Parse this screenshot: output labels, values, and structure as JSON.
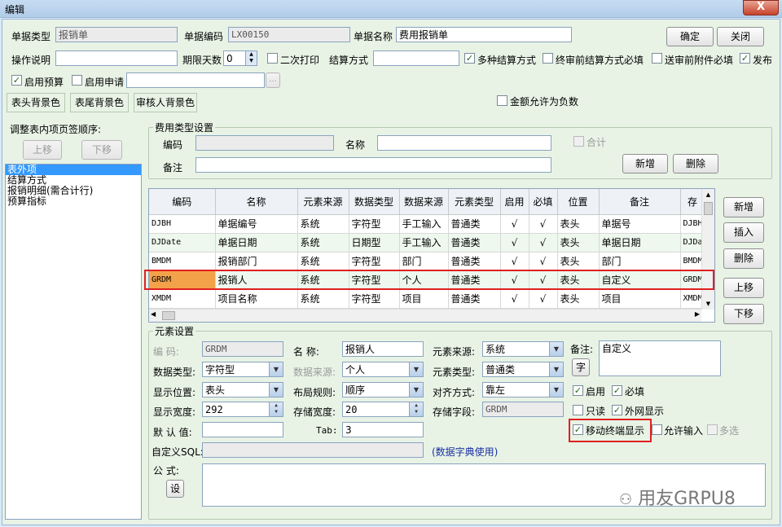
{
  "window": {
    "title": "编辑",
    "close": "X"
  },
  "top": {
    "doc_type_label": "单据类型",
    "doc_type_value": "报销单",
    "doc_code_label": "单据编码",
    "doc_code_value": "LX00150",
    "doc_name_label": "单据名称",
    "doc_name_value": "费用报销单",
    "ok": "确定",
    "close": "关闭",
    "op_desc_label": "操作说明",
    "op_desc_value": "",
    "deadline_label": "期限天数",
    "deadline_value": "0",
    "reprint_label": "二次打印",
    "settle_label": "结算方式",
    "settle_value": "",
    "multi_settle_label": "多种结算方式",
    "final_settle_label": "终审前结算方式必填",
    "attach_label": "送审前附件必填",
    "publish_label": "发布",
    "budget_label": "启用预算",
    "apply_label": "启用申请",
    "apply_value": "",
    "apply_btn": "...",
    "negative_label": "金额允许为负数",
    "tabs": [
      "表头背景色",
      "表尾背景色",
      "审核人背景色"
    ]
  },
  "left": {
    "label": "调整表内项页签顺序:",
    "up": "上移",
    "down": "下移",
    "items": [
      "表外项",
      "结算方式",
      "报销明细(需合计行)",
      "预算指标"
    ]
  },
  "expense": {
    "title": "费用类型设置",
    "code_label": "编码",
    "code_value": "",
    "name_label": "名称",
    "name_value": "",
    "total_label": "合计",
    "note_label": "备注",
    "note_value": "",
    "add": "新增",
    "delete": "删除"
  },
  "grid": {
    "columns": [
      "编码",
      "名称",
      "元素来源",
      "数据类型",
      "数据来源",
      "元素类型",
      "启用",
      "必填",
      "位置",
      "备注",
      "存"
    ],
    "rows": [
      [
        "DJBH",
        "单据编号",
        "系统",
        "字符型",
        "手工输入",
        "普通类",
        "√",
        "√",
        "表头",
        "单据号",
        "DJBH"
      ],
      [
        "DJDate",
        "单据日期",
        "系统",
        "日期型",
        "手工输入",
        "普通类",
        "√",
        "√",
        "表头",
        "单据日期",
        "DJDa"
      ],
      [
        "BMDM",
        "报销部门",
        "系统",
        "字符型",
        "部门",
        "普通类",
        "√",
        "√",
        "表头",
        "部门",
        "BMDM"
      ],
      [
        "GRDM",
        "报销人",
        "系统",
        "字符型",
        "个人",
        "普通类",
        "√",
        "√",
        "表头",
        "自定义",
        "GRDM"
      ],
      [
        "XMDM",
        "项目名称",
        "系统",
        "字符型",
        "项目",
        "普通类",
        "√",
        "√",
        "表头",
        "项目",
        "XMDM"
      ]
    ]
  },
  "side_buttons": [
    "新增",
    "插入",
    "删除",
    "上移",
    "下移"
  ],
  "element": {
    "title": "元素设置",
    "code_label": "编    码:",
    "code_value": "GRDM",
    "name_label": "名    称:",
    "name_value": "报销人",
    "source_label": "元素来源:",
    "source_value": "系统",
    "remark_label": "备注:",
    "remark_value": "自定义",
    "dtype_label": "数据类型:",
    "dtype_value": "字符型",
    "dsource_label": "数据来源:",
    "dsource_value": "个人",
    "etype_label": "元素类型:",
    "etype_value": "普通类",
    "char_btn": "字",
    "pos_label": "显示位置:",
    "pos_value": "表头",
    "layout_label": "布局规则:",
    "layout_value": "顺序",
    "align_label": "对齐方式:",
    "align_value": "靠左",
    "enable_label": "启用",
    "required_label": "必填",
    "width_label": "显示宽度:",
    "width_value": "292",
    "swidth_label": "存储宽度:",
    "swidth_value": "20",
    "sfield_label": "存储字段:",
    "sfield_value": "GRDM",
    "readonly_label": "只读",
    "extnet_label": "外网显示",
    "default_label": "默 认 值:",
    "default_value": "",
    "tab_label": "Tab:",
    "tab_value": "3",
    "mobile_label": "移动终端显示",
    "allow_input_label": "允许输入",
    "multi_label": "多选",
    "sql_label": "自定义SQL:",
    "sql_value": "",
    "sql_hint": "(数据字典使用)",
    "formula_label": "公    式:",
    "set_btn": "设"
  },
  "watermark": "用友GRPU8"
}
